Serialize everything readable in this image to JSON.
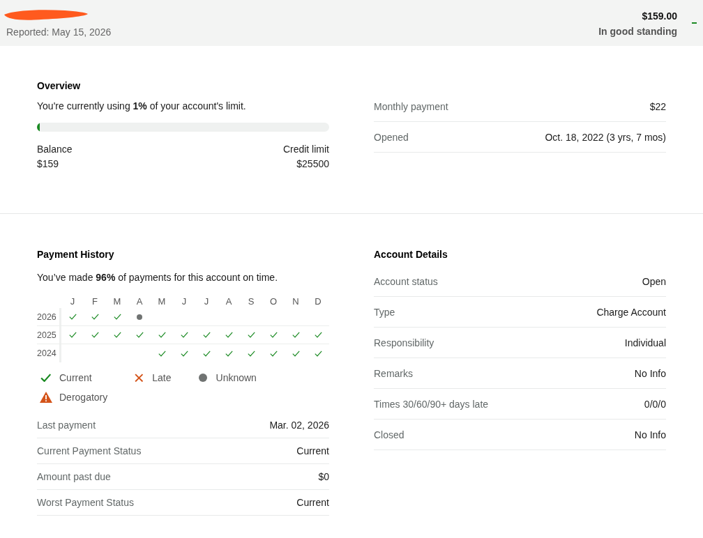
{
  "header": {
    "reported": "Reported: May 15, 2026",
    "amount": "$159.00",
    "standing": "In good standing",
    "expanded": true
  },
  "overview": {
    "title": "Overview",
    "summary": "You're currently using **1%** of your account's limit.",
    "usage": {
      "level": 0.01
    },
    "balance": {
      "label": "Balance",
      "value": "$159"
    },
    "limit": {
      "label": "Credit limit",
      "value": "$25500"
    },
    "rows": [
      {
        "label": "Monthly payment",
        "value": "$22"
      },
      {
        "label": "Opened",
        "value": "Oct. 18, 2022 (3 yrs, 7 mos)"
      }
    ]
  },
  "payment_history": {
    "title": "Payment History",
    "summary": "You’ve made **96%** of payments for this account on time.",
    "months": [
      "J",
      "F",
      "M",
      "A",
      "M",
      "J",
      "J",
      "A",
      "S",
      "O",
      "N",
      "D"
    ],
    "years": [
      {
        "year": "2026",
        "cells": [
          {
            "kind": "current"
          },
          {
            "kind": "current"
          },
          {
            "kind": "current"
          },
          {
            "kind": "unknown"
          },
          {
            "kind": "empty"
          },
          {
            "kind": "empty"
          },
          {
            "kind": "empty"
          },
          {
            "kind": "empty"
          },
          {
            "kind": "empty"
          },
          {
            "kind": "empty"
          },
          {
            "kind": "empty"
          },
          {
            "kind": "empty"
          }
        ]
      },
      {
        "year": "2025",
        "cells": [
          {
            "kind": "current"
          },
          {
            "kind": "current"
          },
          {
            "kind": "current"
          },
          {
            "kind": "current"
          },
          {
            "kind": "current"
          },
          {
            "kind": "current"
          },
          {
            "kind": "current"
          },
          {
            "kind": "current"
          },
          {
            "kind": "current"
          },
          {
            "kind": "current"
          },
          {
            "kind": "current"
          },
          {
            "kind": "current"
          }
        ]
      },
      {
        "year": "2024",
        "cells": [
          {
            "kind": "empty"
          },
          {
            "kind": "empty"
          },
          {
            "kind": "empty"
          },
          {
            "kind": "empty"
          },
          {
            "kind": "current"
          },
          {
            "kind": "current"
          },
          {
            "kind": "current"
          },
          {
            "kind": "current"
          },
          {
            "kind": "current"
          },
          {
            "kind": "current"
          },
          {
            "kind": "current"
          },
          {
            "kind": "current"
          }
        ]
      }
    ],
    "legend": [
      {
        "kind": "current",
        "label": "Current"
      },
      {
        "kind": "late",
        "label": "Late"
      },
      {
        "kind": "unknown",
        "label": "Unknown"
      },
      {
        "kind": "derogatory",
        "label": "Derogatory"
      }
    ],
    "rows": [
      {
        "label": "Last payment",
        "value": "Mar. 02, 2026"
      },
      {
        "label": "Current Payment Status",
        "value": "Current"
      },
      {
        "label": "Amount past due",
        "value": "$0"
      },
      {
        "label": "Worst Payment Status",
        "value": "Current"
      }
    ]
  },
  "account_details": {
    "title": "Account Details",
    "rows": [
      {
        "label": "Account status",
        "value": "Open"
      },
      {
        "label": "Type",
        "value": "Charge Account"
      },
      {
        "label": "Responsibility",
        "value": "Individual"
      },
      {
        "label": "Remarks",
        "value": "No Info"
      },
      {
        "label": "Times 30/60/90+ days late",
        "value": "0/0/0"
      },
      {
        "label": "Closed",
        "value": "No Info"
      }
    ]
  }
}
